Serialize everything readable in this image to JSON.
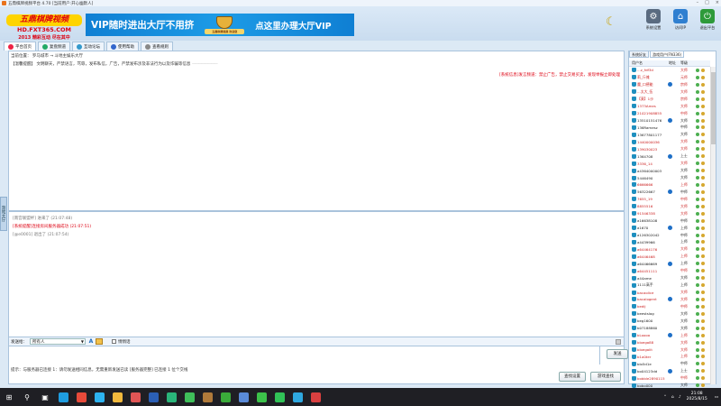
{
  "window": {
    "title": "五鼎棋牌视频平台 4.70 [当前用户:开心幽默人]",
    "controls": [
      "–",
      "□",
      "×"
    ]
  },
  "logo": {
    "line1": "五鼎棋牌视频",
    "line2": "HD.FXT365.COM",
    "line3": "2013 精彩互动 尽在其中"
  },
  "banner": {
    "left": "VIP随时进出大厅不用挤",
    "emblem_text": "五鼎棋牌视频 欢迎您",
    "right": "点这里办理大厅VIP"
  },
  "header_buttons": [
    {
      "label": "系统设置",
      "icon": "gear-icon",
      "color": "#5a6b80"
    },
    {
      "label": "访问IP",
      "icon": "home-icon",
      "color": "#2f7fd0"
    },
    {
      "label": "退出平台",
      "icon": "exit-icon",
      "color": "#2e9a3a"
    }
  ],
  "tabs": [
    {
      "label": "平台首页",
      "color": "#e24"
    },
    {
      "label": "复盘频道",
      "color": "#2a6"
    },
    {
      "label": "互动论坛",
      "color": "#39c"
    },
    {
      "label": "使用帮助",
      "color": "#36c"
    },
    {
      "label": "查看规则",
      "color": "#888"
    }
  ],
  "main": {
    "breadcrumb": "当前位置： 罗马城市 → 斗地主娱乐大厅",
    "notice_label": "【温馨提醒】",
    "notice_text": "文明聊天，严禁语言，骂辱，发布私信，广告，严禁发布涉及非法行为以及诈骗等信息",
    "notice_tail": "————————",
    "system_notice": "[系统信息]发言频道：禁止广告，禁止交易买卖，发现举报立即处理",
    "chat": [
      {
        "text": "[南宫联盟杯] 进来了 (21:07:48)",
        "style": "gray"
      },
      {
        "text": "[系统提醒]连接房间服务器成功 (21:07:51)",
        "style": "red"
      },
      {
        "text": "[@e0001] 退出了 (21:07:54)",
        "style": "gray"
      }
    ],
    "send_to_label": "发送给：",
    "send_to_value": "所有人",
    "whisper_label": "悄悄话",
    "send_button": "发送",
    "status_text": "提示：与服务器已连接    1：请勿发送相同信息，无需重新发送已读 [服务器完整]    已连接  1 位个交线",
    "btn_reset": "查找设置",
    "btn_search": "游戏查找"
  },
  "side_tab": "游戏大厅",
  "right_panel": {
    "tabs": [
      "系统好友",
      "游戏用户(FN336)"
    ],
    "headers": [
      "用户名",
      "地址",
      "等级"
    ],
    "users": [
      {
        "name": "...z_fdf3d",
        "level": "大师",
        "color": "#c22",
        "ip": "#3a6"
      },
      {
        "name": "莉_斤摊",
        "level": "元师",
        "color": "#c22",
        "ip": "#3a6"
      },
      {
        "name": "魔_口德能",
        "level": "宗师",
        "color": "#c22",
        "ip": "#3a6"
      },
      {
        "name": "...太大_伍",
        "level": "大师",
        "color": "#c22",
        "ip": "#3a6"
      },
      {
        "name": "【莫】1沙",
        "level": "宗师",
        "color": "#c22",
        "ip": "#3a6"
      },
      {
        "name": "1373Ames",
        "level": "大师",
        "color": "#c22",
        "ip": "#3a6"
      },
      {
        "name": "21021908855",
        "level": "中师",
        "color": "#c22",
        "ip": "#3a6"
      },
      {
        "name": "13510151476",
        "level": "大师",
        "color": "#222",
        "ip": "#3a6"
      },
      {
        "name": "136Ramesz",
        "level": "中师",
        "color": "#222",
        "ip": "#3a6"
      },
      {
        "name": "13677801177",
        "level": "大师",
        "color": "#222",
        "ip": "#3a6"
      },
      {
        "name": "1440000036",
        "level": "大师",
        "color": "#c22",
        "ip": "#3a6"
      },
      {
        "name": "139030023",
        "level": "大师",
        "color": "#c22",
        "ip": "#3a6"
      },
      {
        "name": "1364708",
        "level": "上士",
        "color": "#222",
        "ip": "#3a6"
      },
      {
        "name": "3336_14",
        "level": "大师",
        "color": "#c22",
        "ip": "#3a6"
      },
      {
        "name": "a4364000003",
        "level": "大师",
        "color": "#222",
        "ip": "#3a6"
      },
      {
        "name": "5446490",
        "level": "大师",
        "color": "#222",
        "ip": "#3a6"
      },
      {
        "name": "6666666",
        "level": "上师",
        "color": "#c22",
        "ip": "#3a6"
      },
      {
        "name": "56322667",
        "level": "中师",
        "color": "#222",
        "ip": "#3a6"
      },
      {
        "name": "7655_19",
        "level": "中师",
        "color": "#c22",
        "ip": "#3a6"
      },
      {
        "name": "8855516",
        "level": "大师",
        "color": "#c22",
        "ip": "#3a6"
      },
      {
        "name": "91546338",
        "level": "大师",
        "color": "#c22",
        "ip": "#3a6"
      },
      {
        "name": "a16638108",
        "level": "中师",
        "color": "#222",
        "ip": "#3a6"
      },
      {
        "name": "a1670",
        "level": "上师",
        "color": "#222",
        "ip": "#3a6"
      },
      {
        "name": "a126302042",
        "level": "中师",
        "color": "#222",
        "ip": "#3a6"
      },
      {
        "name": "a4439966",
        "level": "上师",
        "color": "#222",
        "ip": "#3a6"
      },
      {
        "name": "a64464176",
        "level": "大师",
        "color": "#c22",
        "ip": "#3a6"
      },
      {
        "name": "a6446468",
        "level": "上师",
        "color": "#c22",
        "ip": "#3a6"
      },
      {
        "name": "a64466669",
        "level": "上师",
        "color": "#222",
        "ip": "#3a6"
      },
      {
        "name": "a64451111",
        "level": "中师",
        "color": "#c22",
        "ip": "#3a6"
      },
      {
        "name": "a44ame",
        "level": "大师",
        "color": "#222",
        "ip": "#3a6"
      },
      {
        "name": "1111高手",
        "level": "上师",
        "color": "#222",
        "ip": "#3a6"
      },
      {
        "name": "bacaolice",
        "level": "大师",
        "color": "#c22",
        "ip": "#3a6"
      },
      {
        "name": "bacalogent",
        "level": "大师",
        "color": "#c22",
        "ip": "#3a6"
      },
      {
        "name": "bedij",
        "level": "中师",
        "color": "#c22",
        "ip": "#3a6"
      },
      {
        "name": "beestslog",
        "level": "大师",
        "color": "#222",
        "ip": "#3a6"
      },
      {
        "name": "beg1600",
        "level": "大师",
        "color": "#222",
        "ip": "#3a6"
      },
      {
        "name": "b07188860",
        "level": "大师",
        "color": "#222",
        "ip": "#3a6"
      },
      {
        "name": "bLoooa",
        "level": "上师",
        "color": "#c22",
        "ip": "#3a6"
      },
      {
        "name": "bloega88",
        "level": "大师",
        "color": "#c22",
        "ip": "#3a6"
      },
      {
        "name": "bloegalit",
        "level": "大师",
        "color": "#c22",
        "ip": "#3a6"
      },
      {
        "name": "b1a0ter",
        "level": "上师",
        "color": "#c22",
        "ip": "#3a6"
      },
      {
        "name": "blo5d1e",
        "level": "中师",
        "color": "#222",
        "ip": "#3a6"
      },
      {
        "name": "bo04123dd",
        "level": "上士",
        "color": "#222",
        "ip": "#3a6"
      },
      {
        "name": "bobble2890115",
        "level": "中师",
        "color": "#c22",
        "ip": "#3a6"
      },
      {
        "name": "bobo000",
        "level": "大师",
        "color": "#222",
        "ip": "#3a6"
      },
      {
        "name": "bo0j3",
        "level": "大师",
        "color": "#c22",
        "ip": "#3a6"
      },
      {
        "name": "bolice009",
        "level": "上师",
        "color": "#222",
        "ip": "#3a6"
      },
      {
        "name": "bocaolice",
        "level": "大师",
        "color": "#222",
        "ip": "#3a6"
      },
      {
        "name": "bug8a8d0",
        "level": "中师",
        "color": "#222",
        "ip": "#3a6"
      }
    ]
  },
  "taskbar": {
    "apps": [
      {
        "icon": "windows-icon",
        "color": "#ffffff"
      },
      {
        "icon": "search-icon",
        "color": "#ffffff"
      },
      {
        "icon": "taskview-icon",
        "color": "#ffffff"
      },
      {
        "icon": "edge-icon",
        "color": "#1f9de0"
      },
      {
        "icon": "chrome-icon",
        "color": "#e84a3a"
      },
      {
        "icon": "qq-icon",
        "color": "#2db3f0"
      },
      {
        "icon": "folder-icon",
        "color": "#f2b93d"
      },
      {
        "icon": "app-icon",
        "color": "#e05555"
      },
      {
        "icon": "word-icon",
        "color": "#2b5fb5"
      },
      {
        "icon": "browser-icon",
        "color": "#2ab57a"
      },
      {
        "icon": "game-icon",
        "color": "#3fbf5a"
      },
      {
        "icon": "box-icon",
        "color": "#b07a3a"
      },
      {
        "icon": "green-app-icon",
        "color": "#3aaa3a"
      },
      {
        "icon": "blue-app-icon",
        "color": "#5a8ad8"
      },
      {
        "icon": "wechat-icon",
        "color": "#3cc24a"
      },
      {
        "icon": "chat-icon",
        "color": "#31c257"
      },
      {
        "icon": "video-icon",
        "color": "#2fa8e0"
      },
      {
        "icon": "game2-icon",
        "color": "#d94040"
      }
    ],
    "time": "21:08",
    "date": "2025/8/15"
  }
}
